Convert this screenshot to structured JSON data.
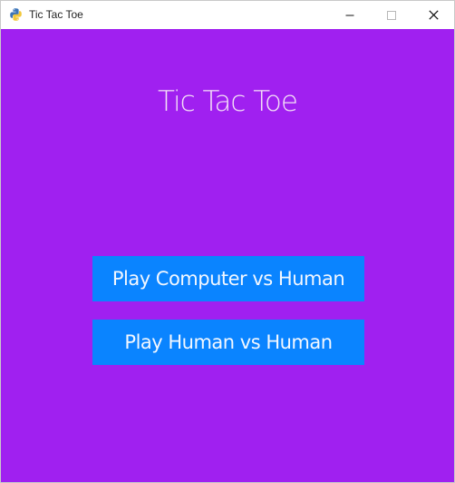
{
  "window": {
    "title": "Tic Tac Toe",
    "app_icon": "python-icon",
    "controls": [
      "minimize-icon",
      "maximize-icon",
      "close-icon"
    ]
  },
  "game": {
    "heading": "Tic Tac Toe",
    "buttons": {
      "computer_vs_human": "Play Computer vs Human",
      "human_vs_human": "Play Human vs Human"
    }
  },
  "colors": {
    "background": "#a020f0",
    "button": "#0a84ff",
    "heading_text": "#f3dff6",
    "button_text": "#f2f7ff"
  }
}
